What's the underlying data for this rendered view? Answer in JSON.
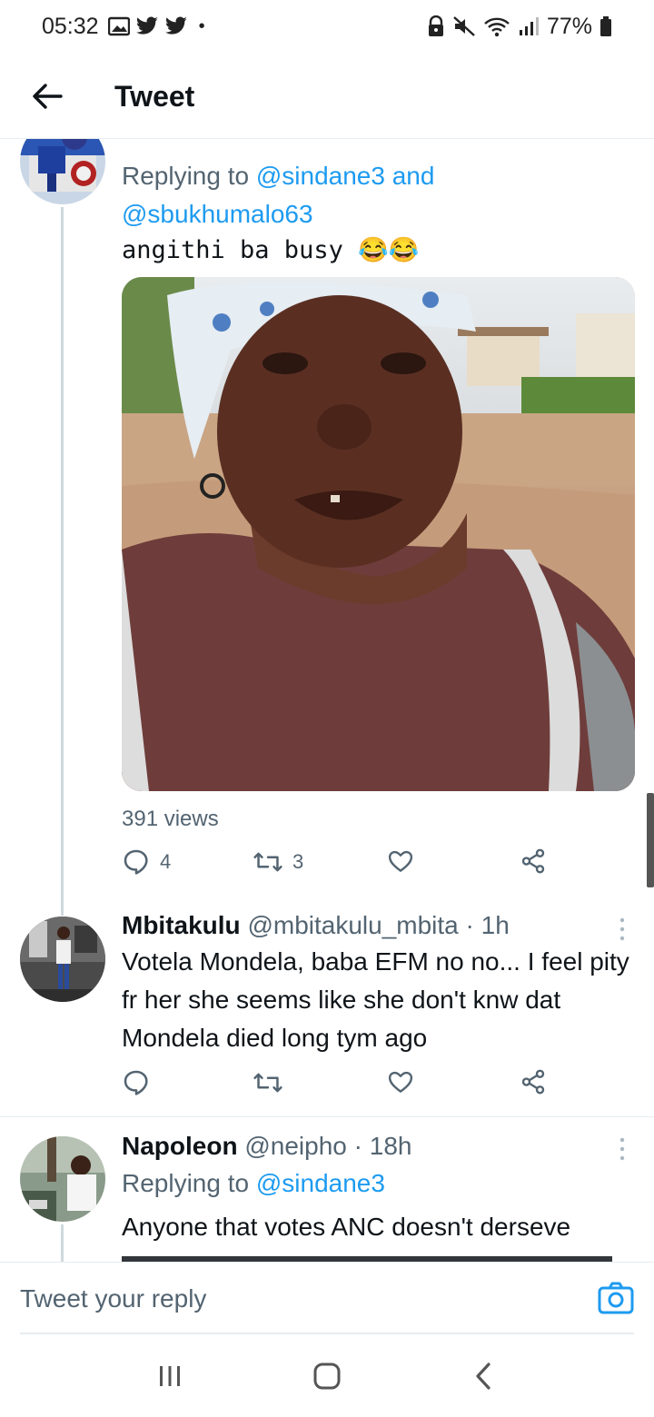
{
  "status_bar": {
    "time": "05:32",
    "battery": "77%",
    "dot": "•"
  },
  "header": {
    "title": "Tweet"
  },
  "tweets": [
    {
      "replying_prefix": "Replying to",
      "replying_mention_1": "@sindane3",
      "replying_and": "and",
      "replying_mention_2": "@sbukhumalo63",
      "text": "angithi ba busy 😂😂",
      "views": "391 views",
      "replies": "4",
      "retweets": "3",
      "likes": ""
    },
    {
      "display_name": "Mbitakulu",
      "handle": "@mbitakulu_mbita",
      "sep": "·",
      "time": "1h",
      "text": "Votela Mondela, baba EFM no no... I feel pity fr her she seems like she don't knw dat Mondela died long tym ago"
    },
    {
      "display_name": "Napoleon",
      "handle": "@neipho",
      "sep": "·",
      "time": "18h",
      "replying_prefix": "Replying to",
      "replying_mention_1": "@sindane3",
      "text": "Anyone that votes ANC doesn't derseve"
    }
  ],
  "reply_bar": {
    "placeholder": "Tweet your reply"
  },
  "icons": {
    "back": "arrow-left-icon",
    "camera": "camera-icon",
    "reply": "reply-icon",
    "retweet": "retweet-icon",
    "like": "heart-icon",
    "share": "share-icon"
  },
  "colors": {
    "accent": "#1d9bf0",
    "text": "#0f1419",
    "secondary": "#536471"
  }
}
